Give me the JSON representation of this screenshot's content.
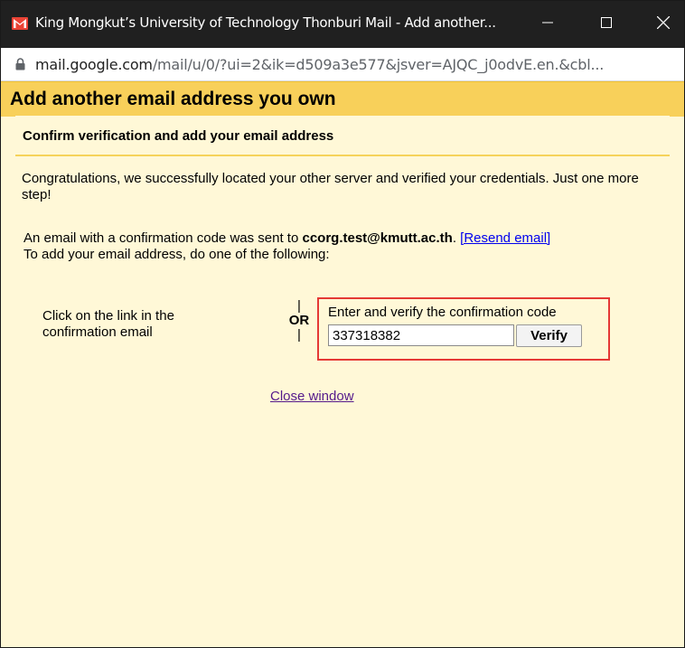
{
  "window": {
    "title": "King Mongkut’s University of Technology Thonburi Mail - Add another...",
    "logo_icon": "gmail-icon",
    "controls": {
      "minimize_icon": "minimize-icon",
      "maximize_icon": "maximize-icon",
      "close_icon": "close-icon"
    }
  },
  "address_bar": {
    "host": "mail.google.com",
    "path": "/mail/u/0/?ui=2&ik=d509a3e577&jsver=AJQC_j0odvE.en.&cbl...",
    "lock_icon": "lock-icon"
  },
  "dialog": {
    "title": "Add another email address you own",
    "subtitle": "Confirm verification and add your email address",
    "success_message": "Congratulations, we successfully located your other server and verified your credentials. Just one more step!",
    "sent_prefix": "An email with a confirmation code was sent to ",
    "email": "ccorg.test@kmutt.ac.th",
    "sent_suffix": ". ",
    "resend_link": "[Resend email]",
    "instruction": "To add your email address, do one of the following:",
    "option_link_text": "Click on the link in the confirmation email",
    "or_bar_top": "|",
    "or_label": "OR",
    "or_bar_bottom": "|",
    "code_label": "Enter and verify the confirmation code",
    "code_value": "337318382",
    "verify_button": "Verify",
    "close_link": "Close window"
  },
  "colors": {
    "titlebar": "#202020",
    "header": "#f8d05a",
    "background": "#fff8d7",
    "highlight_border": "#e53935",
    "link": "#0000ee",
    "visited_link": "#551a8b"
  }
}
